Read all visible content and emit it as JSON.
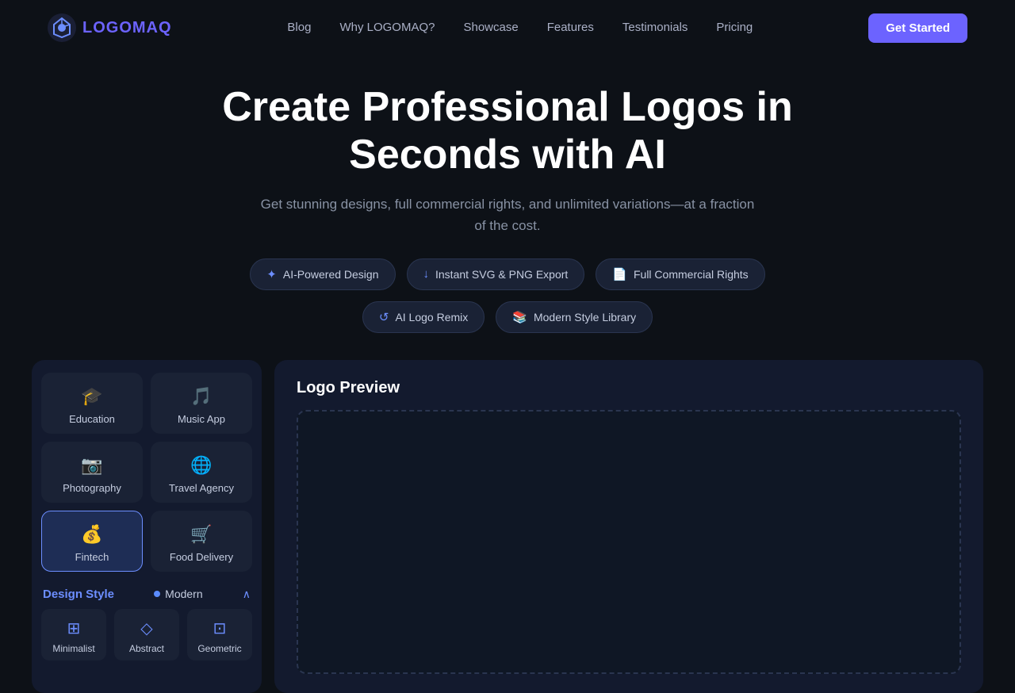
{
  "logo": {
    "icon_label": "logomaq-icon",
    "text": "LOGOMAQ"
  },
  "nav": {
    "links": [
      {
        "label": "Blog",
        "href": "#"
      },
      {
        "label": "Why LOGOMAQ?",
        "href": "#"
      },
      {
        "label": "Showcase",
        "href": "#"
      },
      {
        "label": "Features",
        "href": "#"
      },
      {
        "label": "Testimonials",
        "href": "#"
      },
      {
        "label": "Pricing",
        "href": "#"
      }
    ],
    "cta": "Get Started"
  },
  "hero": {
    "title_line1": "Create Professional Logos in",
    "title_line2": "Seconds with AI",
    "subtitle": "Get stunning designs, full commercial rights, and unlimited variations—at a fraction of the cost.",
    "badges_row1": [
      {
        "icon": "✦",
        "label": "AI-Powered Design"
      },
      {
        "icon": "↓",
        "label": "Instant SVG & PNG Export"
      },
      {
        "icon": "📄",
        "label": "Full Commercial Rights"
      }
    ],
    "badges_row2": [
      {
        "icon": "↺",
        "label": "AI Logo Remix"
      },
      {
        "icon": "📚",
        "label": "Modern Style Library"
      }
    ]
  },
  "categories": [
    {
      "icon": "🎓",
      "label": "Education",
      "active": false
    },
    {
      "icon": "🎵",
      "label": "Music App",
      "active": false
    },
    {
      "icon": "📷",
      "label": "Photography",
      "active": false
    },
    {
      "icon": "🌐",
      "label": "Travel Agency",
      "active": false
    },
    {
      "icon": "💰",
      "label": "Fintech",
      "active": true
    },
    {
      "icon": "🛒",
      "label": "Food Delivery",
      "active": false
    }
  ],
  "design_style": {
    "title": "Design Style",
    "current": "Modern",
    "chevron": "∧",
    "styles": [
      {
        "icon": "⊞",
        "label": "Minimalist"
      },
      {
        "icon": "◇",
        "label": "Abstract"
      },
      {
        "icon": "⊡",
        "label": "Geometric"
      }
    ]
  },
  "preview": {
    "title": "Logo Preview"
  }
}
